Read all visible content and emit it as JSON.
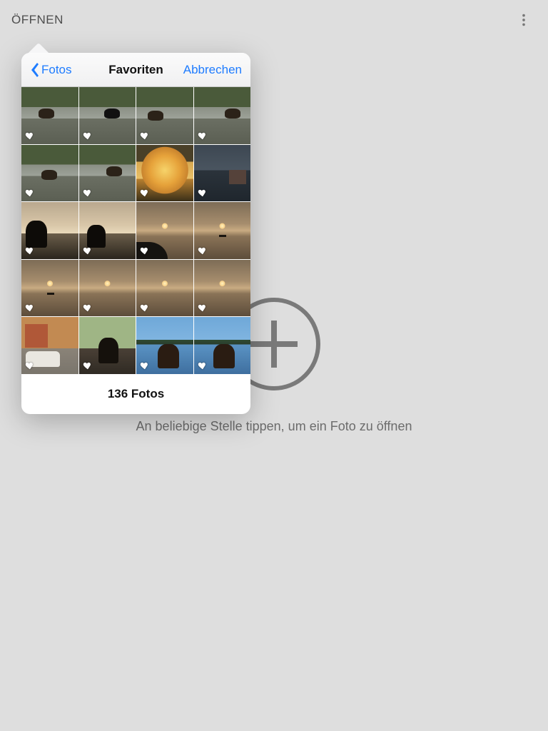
{
  "topbar": {
    "title": "ÖFFNEN"
  },
  "empty": {
    "hint": "An beliebige Stelle tippen, um ein Foto zu öffnen"
  },
  "popover": {
    "back_label": "Fotos",
    "title": "Favoriten",
    "cancel_label": "Abbrechen",
    "footer": "136 Fotos",
    "thumbs": [
      {
        "scene": "scene-river"
      },
      {
        "scene": "scene-river v2"
      },
      {
        "scene": "scene-river v3"
      },
      {
        "scene": "scene-river v4"
      },
      {
        "scene": "scene-river v5"
      },
      {
        "scene": "scene-river v6"
      },
      {
        "scene": "scene-autumn"
      },
      {
        "scene": "scene-duskbuild"
      },
      {
        "scene": "scene-silh"
      },
      {
        "scene": "scene-silh v2"
      },
      {
        "scene": "scene-sunset kayak"
      },
      {
        "scene": "scene-sunset flat"
      },
      {
        "scene": "scene-sunset flat"
      },
      {
        "scene": "scene-sunset"
      },
      {
        "scene": "scene-sunset"
      },
      {
        "scene": "scene-sunset"
      },
      {
        "scene": "scene-car"
      },
      {
        "scene": "scene-dogboat"
      },
      {
        "scene": "scene-bluelake v2"
      },
      {
        "scene": "scene-bluelake v3"
      }
    ]
  }
}
